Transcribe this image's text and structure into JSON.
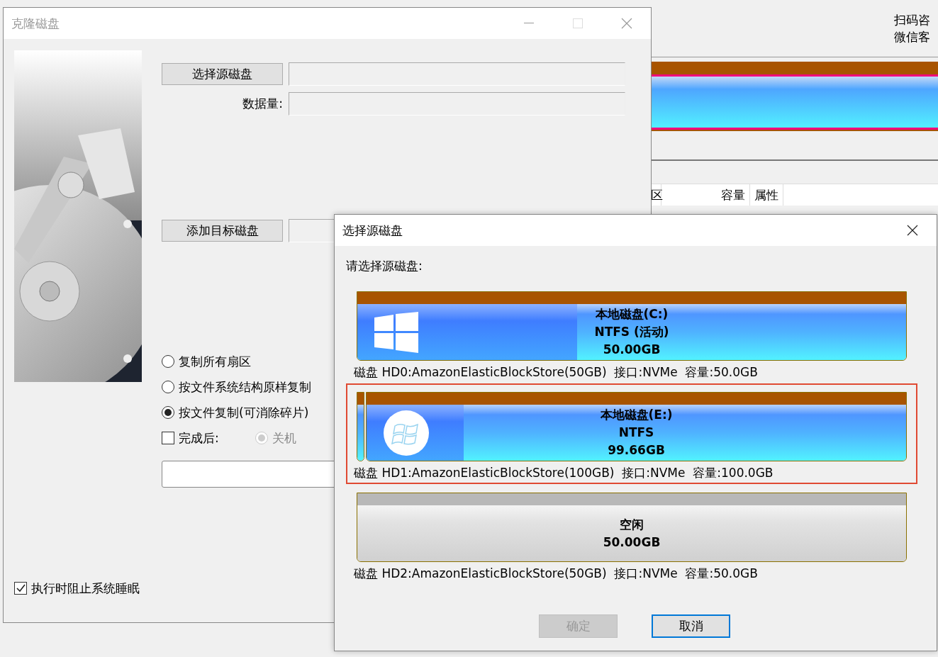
{
  "background_app": {
    "header_lines": [
      "扫码咨",
      "微信客"
    ],
    "columns": [
      "区",
      "容量",
      "属性"
    ]
  },
  "clone_dialog": {
    "title": "克隆磁盘",
    "source_button": "选择源磁盘",
    "data_label": "数据量:",
    "target_button": "添加目标磁盘",
    "copy_modes": [
      {
        "label": "复制所有扇区",
        "selected": false
      },
      {
        "label": "按文件系统结构原样复制",
        "selected": false
      },
      {
        "label": "按文件复制(可消除碎片)",
        "selected": true
      }
    ],
    "after_done": {
      "label": "完成后:",
      "checked": false,
      "option": {
        "label": "关机",
        "selected": true,
        "disabled": true
      }
    },
    "prevent_sleep": {
      "label": "执行时阻止系统睡眠",
      "checked": true
    }
  },
  "source_dialog": {
    "title": "选择源磁盘",
    "prompt": "请选择源磁盘:",
    "disks": [
      {
        "kind": "system",
        "selected": false,
        "lines": [
          "本地磁盘(C:)",
          "NTFS (活动)",
          "50.00GB"
        ],
        "info": "磁盘 HD0:AmazonElasticBlockStore(50GB)  接口:NVMe  容量:50.0GB"
      },
      {
        "kind": "data",
        "selected": true,
        "lines": [
          "本地磁盘(E:)",
          "NTFS",
          "99.66GB"
        ],
        "info": "磁盘 HD1:AmazonElasticBlockStore(100GB)  接口:NVMe  容量:100.0GB"
      },
      {
        "kind": "free",
        "selected": false,
        "lines": [
          "空闲",
          "50.00GB"
        ],
        "info": "磁盘 HD2:AmazonElasticBlockStore(50GB)  接口:NVMe  容量:50.0GB"
      }
    ],
    "buttons": [
      {
        "label": "确定",
        "disabled": true,
        "default": false
      },
      {
        "label": "取消",
        "disabled": false,
        "default": true
      }
    ]
  }
}
